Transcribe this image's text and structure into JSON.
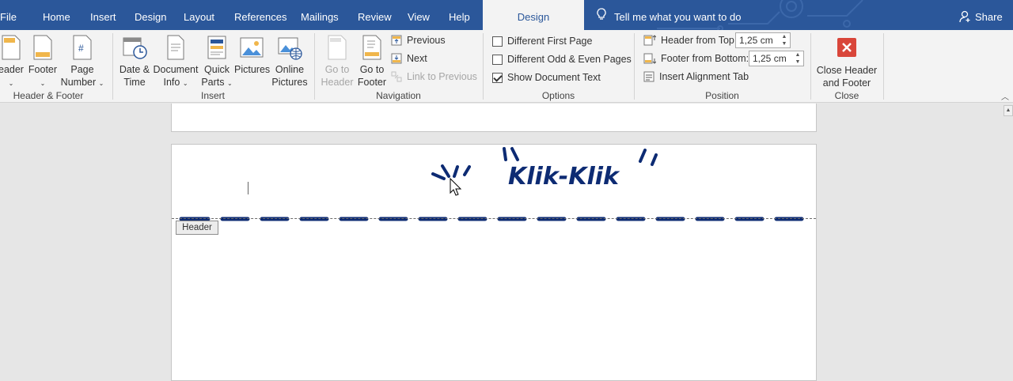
{
  "tabs": [
    {
      "label": "File"
    },
    {
      "label": "Home"
    },
    {
      "label": "Insert"
    },
    {
      "label": "Design"
    },
    {
      "label": "Layout"
    },
    {
      "label": "References"
    },
    {
      "label": "Mailings"
    },
    {
      "label": "Review"
    },
    {
      "label": "View"
    },
    {
      "label": "Help"
    },
    {
      "label": "Design"
    }
  ],
  "tell_me": "Tell me what you want to do",
  "share": "Share",
  "groups": {
    "header_footer": {
      "label": "Header & Footer",
      "header_line1": "eader",
      "footer": "Footer",
      "page_number_1": "Page",
      "page_number_2": "Number"
    },
    "insert": {
      "label": "Insert",
      "date_time_1": "Date &",
      "date_time_2": "Time",
      "doc_info_1": "Document",
      "doc_info_2": "Info",
      "quick_parts_1": "Quick",
      "quick_parts_2": "Parts",
      "pictures": "Pictures",
      "online_pictures_1": "Online",
      "online_pictures_2": "Pictures"
    },
    "navigation": {
      "label": "Navigation",
      "go_to_header_1": "Go to",
      "go_to_header_2": "Header",
      "go_to_footer_1": "Go to",
      "go_to_footer_2": "Footer",
      "previous": "Previous",
      "next": "Next",
      "link_to_previous": "Link to Previous"
    },
    "options": {
      "label": "Options",
      "different_first_page": "Different First Page",
      "different_odd_even": "Different Odd & Even Pages",
      "show_document_text": "Show Document Text"
    },
    "position": {
      "label": "Position",
      "header_from_top": "Header from Top:",
      "header_from_top_value": "1,25 cm",
      "footer_from_bottom": "Footer from Bottom:",
      "footer_from_bottom_value": "1,25 cm",
      "insert_alignment_tab": "Insert Alignment Tab"
    },
    "close": {
      "label": "Close",
      "close_1": "Close Header",
      "close_2": "and Footer"
    }
  },
  "document": {
    "header_tag": "Header",
    "header_text": "Klik-Klik"
  },
  "colors": {
    "accent": "#2b579a",
    "close_red": "#d9463a",
    "header_art": "#0d2b73"
  }
}
